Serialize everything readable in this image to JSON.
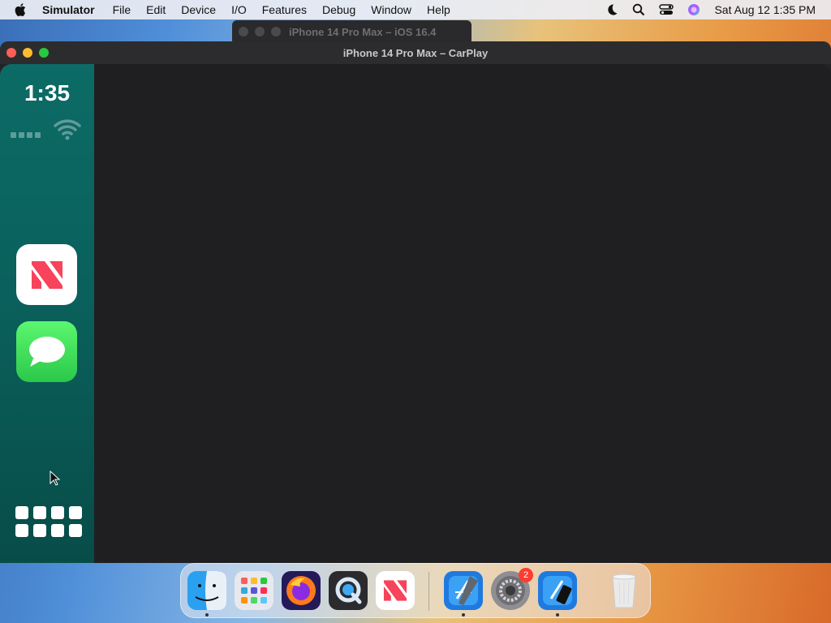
{
  "menubar": {
    "app_name": "Simulator",
    "items": [
      "File",
      "Edit",
      "Device",
      "I/O",
      "Features",
      "Debug",
      "Window",
      "Help"
    ],
    "clock": "Sat Aug 12  1:35 PM"
  },
  "background_window": {
    "title": "iPhone 14 Pro Max – iOS 16.4"
  },
  "window": {
    "title": "iPhone 14 Pro Max – CarPlay"
  },
  "carplay": {
    "time": "1:35",
    "apps": [
      {
        "name": "News",
        "icon": "news-icon"
      },
      {
        "name": "Messages",
        "icon": "messages-icon"
      }
    ]
  },
  "dock": {
    "items": [
      {
        "name": "Finder",
        "icon": "finder-icon",
        "running": true
      },
      {
        "name": "Launchpad",
        "icon": "launchpad-icon",
        "running": false
      },
      {
        "name": "Firefox",
        "icon": "firefox-icon",
        "running": false
      },
      {
        "name": "QuickTime Player",
        "icon": "quicktime-icon",
        "running": false
      },
      {
        "name": "News",
        "icon": "news-icon",
        "running": false
      },
      {
        "name": "Xcode",
        "icon": "xcode-icon",
        "running": true
      },
      {
        "name": "System Settings",
        "icon": "settings-icon",
        "running": false,
        "badge": "2"
      },
      {
        "name": "Simulator",
        "icon": "simulator-icon",
        "running": true
      },
      {
        "name": "Trash",
        "icon": "trash-icon",
        "running": false
      }
    ]
  },
  "colors": {
    "sidebar": "#0a5f5b",
    "screen_bg": "#1f1f22",
    "messages_green": "#34c759",
    "news_red": "#f7435b"
  }
}
